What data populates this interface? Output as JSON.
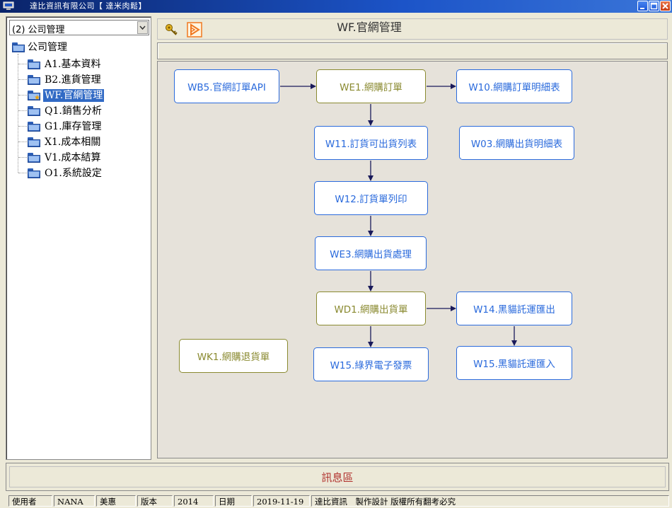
{
  "window": {
    "title": "達比資訊有限公司【 達米肉鬆】",
    "colors": {
      "titlebar": "#0a246a",
      "accent": "#316ac5",
      "node_blue": "#2a6adc",
      "node_olive": "#8a8a30",
      "message": "#b0302c"
    }
  },
  "sidebar": {
    "combo_value": "(2) 公司管理",
    "root_label": "公司管理",
    "items": [
      {
        "label": "A1.基本資料",
        "icon": "folder-icon"
      },
      {
        "label": "B2.進貨管理",
        "icon": "folder-icon"
      },
      {
        "label": "WF.官網管理",
        "icon": "folder-star-icon",
        "selected": true
      },
      {
        "label": "Q1.銷售分析",
        "icon": "folder-icon"
      },
      {
        "label": "G1.庫存管理",
        "icon": "folder-icon"
      },
      {
        "label": "X1.成本相關",
        "icon": "folder-icon"
      },
      {
        "label": "V1.成本結算",
        "icon": "folder-icon"
      },
      {
        "label": "O1.系統設定",
        "icon": "folder-icon"
      }
    ]
  },
  "toolbar": {
    "title": "WF.官網管理",
    "icons": [
      "key-icon",
      "play-icon"
    ]
  },
  "flow": {
    "nodes": [
      {
        "id": "wb5",
        "label": "WB5.官網訂單API",
        "style": "blue"
      },
      {
        "id": "we1",
        "label": "WE1.網購訂單",
        "style": "olive"
      },
      {
        "id": "w10",
        "label": "W10.網購訂單明細表",
        "style": "blue"
      },
      {
        "id": "w11",
        "label": "W11.訂貨可出貨列表",
        "style": "blue"
      },
      {
        "id": "w03",
        "label": "W03.網購出貨明細表",
        "style": "blue"
      },
      {
        "id": "w12",
        "label": "W12.訂貨單列印",
        "style": "blue"
      },
      {
        "id": "we3",
        "label": "WE3.網購出貨處理",
        "style": "blue"
      },
      {
        "id": "wd1",
        "label": "WD1.網購出貨單",
        "style": "olive"
      },
      {
        "id": "w14",
        "label": "W14.黑貓託運匯出",
        "style": "blue"
      },
      {
        "id": "wk1",
        "label": "WK1.網購退貨單",
        "style": "olive"
      },
      {
        "id": "w15a",
        "label": "W15.綠界電子發票",
        "style": "blue"
      },
      {
        "id": "w15b",
        "label": "W15.黑貓託運匯入",
        "style": "blue"
      }
    ]
  },
  "message_area": {
    "label": "訊息區"
  },
  "statusbar": {
    "cells": [
      "使用者",
      "NANA",
      "美惠",
      "版本",
      "2014",
      "日期",
      "2019-11-19",
      "達比資訊　製作設計 版權所有翻考必究"
    ]
  }
}
